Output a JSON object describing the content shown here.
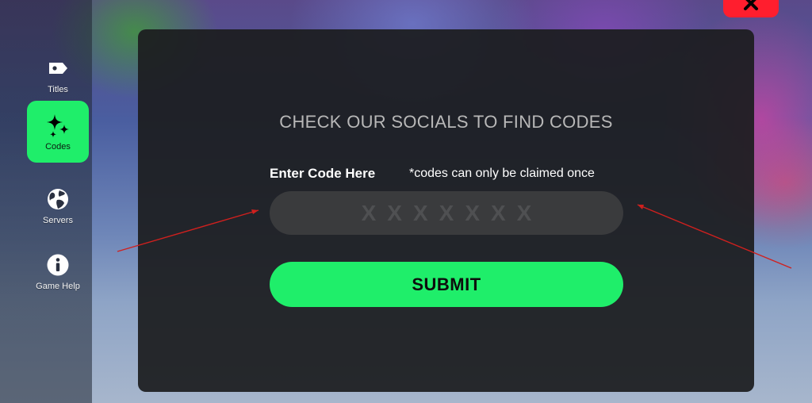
{
  "sidebar": {
    "items": [
      {
        "label": "Titles",
        "icon": "tag-icon",
        "active": false
      },
      {
        "label": "Codes",
        "icon": "sparkles-icon",
        "active": true
      },
      {
        "label": "Servers",
        "icon": "globe-icon",
        "active": false
      },
      {
        "label": "Game Help",
        "icon": "info-icon",
        "active": false
      }
    ]
  },
  "close_button": {
    "icon": "close-icon",
    "color": "#ff1e2e"
  },
  "modal": {
    "title": "CHECK OUR SOCIALS TO FIND CODES",
    "enter_label": "Enter Code Here",
    "claim_note": "*codes can only be claimed once",
    "input_placeholder": "XXXXXXX",
    "submit_label": "SUBMIT"
  },
  "colors": {
    "accent": "#1fee6a",
    "close": "#ff1e2e",
    "annotation_arrow": "#d0201e"
  }
}
